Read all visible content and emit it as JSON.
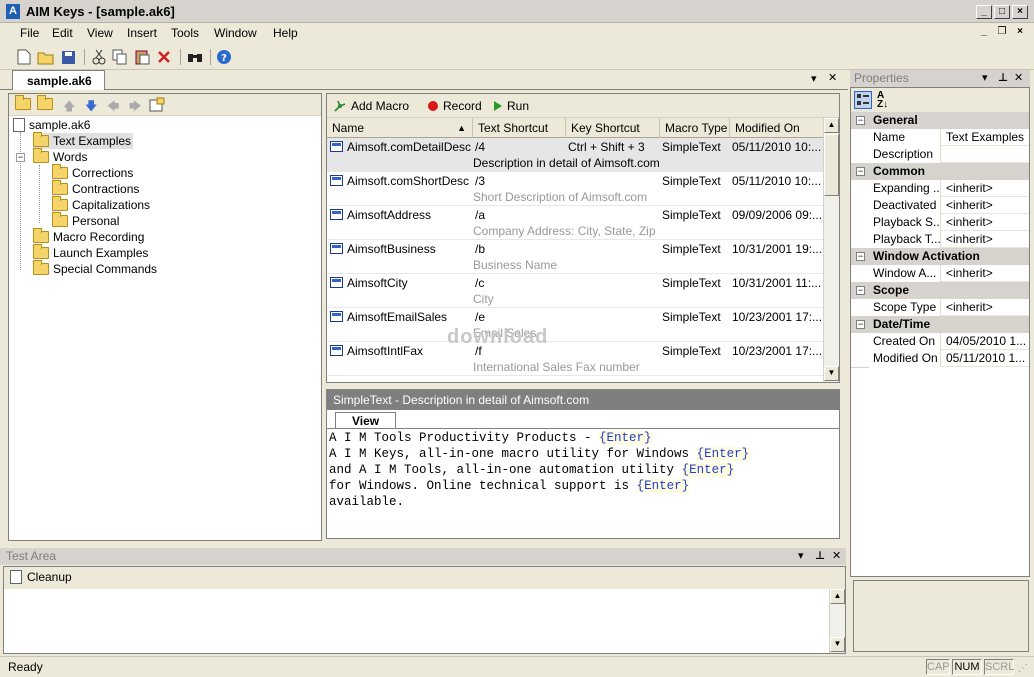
{
  "window": {
    "title": "AIM Keys - [sample.ak6]"
  },
  "menu": [
    "File",
    "Edit",
    "View",
    "Insert",
    "Tools",
    "Window",
    "Help"
  ],
  "toolbar_icons": [
    "new-icon",
    "open-icon",
    "save-icon",
    "cut-icon",
    "copy-icon",
    "paste-icon",
    "delete-icon",
    "find-icon",
    "help-icon"
  ],
  "doc_tab": "sample.ak6",
  "tree": {
    "root": "sample.ak6",
    "items": [
      {
        "label": "Text Examples",
        "level": 1,
        "selected": true
      },
      {
        "label": "Words",
        "level": 1,
        "expanded": true
      },
      {
        "label": "Corrections",
        "level": 2
      },
      {
        "label": "Contractions",
        "level": 2
      },
      {
        "label": "Capitalizations",
        "level": 2
      },
      {
        "label": "Personal",
        "level": 2
      },
      {
        "label": "Macro Recording",
        "level": 1
      },
      {
        "label": "Launch Examples",
        "level": 1
      },
      {
        "label": "Special Commands",
        "level": 1
      }
    ]
  },
  "list_toolbar": {
    "add_macro": "Add Macro",
    "record": "Record",
    "run": "Run"
  },
  "columns": [
    "Name",
    "Text Shortcut",
    "Key Shortcut",
    "Macro Type",
    "Modified On"
  ],
  "macros": [
    {
      "name": "Aimsoft.comDetailDesc",
      "text_shortcut": "/4",
      "key_shortcut": "Ctrl + Shift + 3",
      "type": "SimpleText",
      "modified": "05/11/2010 10:...",
      "description": "Description in detail of Aimsoft.com"
    },
    {
      "name": "Aimsoft.comShortDesc",
      "text_shortcut": "/3",
      "key_shortcut": "",
      "type": "SimpleText",
      "modified": "05/11/2010 10:...",
      "description": "Short Description of Aimsoft.com"
    },
    {
      "name": "AimsoftAddress",
      "text_shortcut": "/a",
      "key_shortcut": "",
      "type": "SimpleText",
      "modified": "09/09/2006 09:...",
      "description": "Company Address: City, State, Zip"
    },
    {
      "name": "AimsoftBusiness",
      "text_shortcut": "/b",
      "key_shortcut": "",
      "type": "SimpleText",
      "modified": "10/31/2001 19:...",
      "description": "Business Name"
    },
    {
      "name": "AimsoftCity",
      "text_shortcut": "/c",
      "key_shortcut": "",
      "type": "SimpleText",
      "modified": "10/31/2001 11:...",
      "description": "City"
    },
    {
      "name": "AimsoftEmailSales",
      "text_shortcut": "/e",
      "key_shortcut": "",
      "type": "SimpleText",
      "modified": "10/23/2001 17:...",
      "description": "Email Sales"
    },
    {
      "name": "AimsoftIntlFax",
      "text_shortcut": "/f",
      "key_shortcut": "",
      "type": "SimpleText",
      "modified": "10/23/2001 17:...",
      "description": "International Sales Fax number"
    }
  ],
  "editor": {
    "title": "SimpleText  -  Description in detail of Aimsoft.com",
    "tab": "View",
    "lines": [
      {
        "text": "A I M Tools Productivity Products - ",
        "enter": "{Enter}"
      },
      {
        "text": "A I M Keys, all-in-one macro utility for Windows ",
        "enter": "{Enter}"
      },
      {
        "text": "and A I M Tools, all-in-one automation utility ",
        "enter": "{Enter}"
      },
      {
        "text": "for Windows. Online technical support is ",
        "enter": "{Enter}"
      },
      {
        "text": "available.",
        "enter": ""
      }
    ]
  },
  "properties": {
    "header": "Properties",
    "groups": [
      {
        "name": "General",
        "rows": [
          {
            "name": "Name",
            "value": "Text Examples"
          },
          {
            "name": "Description",
            "value": ""
          }
        ]
      },
      {
        "name": "Common",
        "rows": [
          {
            "name": "Expanding ...",
            "value": "<inherit>"
          },
          {
            "name": "Deactivated",
            "value": "<inherit>"
          },
          {
            "name": "Playback S...",
            "value": "<inherit>"
          },
          {
            "name": "Playback T...",
            "value": "<inherit>"
          }
        ]
      },
      {
        "name": "Window Activation",
        "rows": [
          {
            "name": "Window A...",
            "value": "<inherit>"
          }
        ]
      },
      {
        "name": "Scope",
        "rows": [
          {
            "name": "Scope Type",
            "value": "<inherit>"
          }
        ]
      },
      {
        "name": "Date/Time",
        "rows": [
          {
            "name": "Created On",
            "value": "04/05/2010 1..."
          },
          {
            "name": "Modified On",
            "value": "05/11/2010 1..."
          }
        ]
      }
    ]
  },
  "test_area": {
    "header": "Test Area",
    "cleanup": "Cleanup"
  },
  "status": {
    "text": "Ready",
    "indicators": [
      {
        "label": "CAP",
        "on": false
      },
      {
        "label": "NUM",
        "on": true
      },
      {
        "label": "SCRL",
        "on": false
      }
    ]
  },
  "watermark": "download"
}
